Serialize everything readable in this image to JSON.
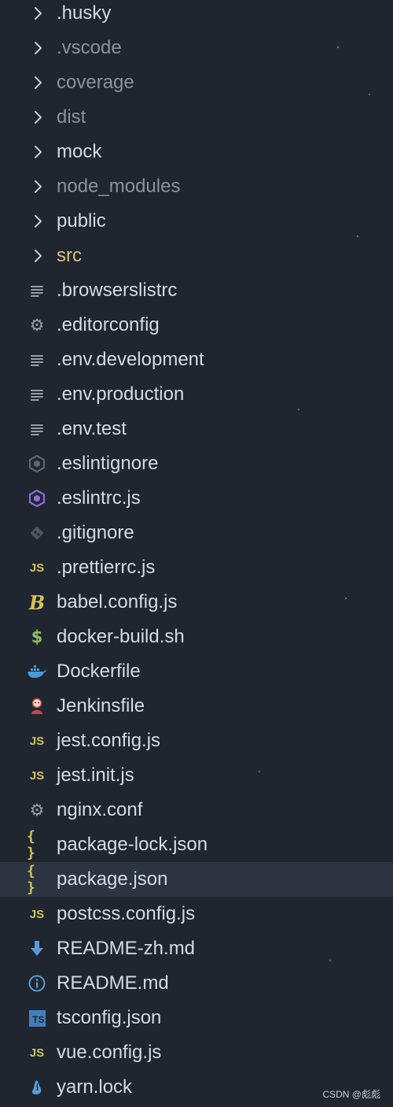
{
  "explorer": {
    "items": [
      {
        "label": ".husky",
        "kind": "folder",
        "icon": "chevron-right-icon"
      },
      {
        "label": ".vscode",
        "kind": "folder",
        "icon": "chevron-right-icon"
      },
      {
        "label": "coverage",
        "kind": "folder",
        "icon": "chevron-right-icon"
      },
      {
        "label": "dist",
        "kind": "folder",
        "icon": "chevron-right-icon"
      },
      {
        "label": "mock",
        "kind": "folder",
        "icon": "chevron-right-icon"
      },
      {
        "label": "node_modules",
        "kind": "folder",
        "icon": "chevron-right-icon"
      },
      {
        "label": "public",
        "kind": "folder",
        "icon": "chevron-right-icon"
      },
      {
        "label": "src",
        "kind": "folder",
        "icon": "chevron-right-icon"
      },
      {
        "label": ".browserslistrc",
        "kind": "file",
        "icon": "text-lines-icon"
      },
      {
        "label": ".editorconfig",
        "kind": "file",
        "icon": "gear-icon"
      },
      {
        "label": ".env.development",
        "kind": "file",
        "icon": "text-lines-icon"
      },
      {
        "label": ".env.production",
        "kind": "file",
        "icon": "text-lines-icon"
      },
      {
        "label": ".env.test",
        "kind": "file",
        "icon": "text-lines-icon"
      },
      {
        "label": ".eslintignore",
        "kind": "file",
        "icon": "eslint-gray-icon"
      },
      {
        "label": ".eslintrc.js",
        "kind": "file",
        "icon": "eslint-icon"
      },
      {
        "label": ".gitignore",
        "kind": "file",
        "icon": "git-icon"
      },
      {
        "label": ".prettierrc.js",
        "kind": "file",
        "icon": "javascript-icon"
      },
      {
        "label": "babel.config.js",
        "kind": "file",
        "icon": "babel-icon"
      },
      {
        "label": "docker-build.sh",
        "kind": "file",
        "icon": "shell-dollar-icon"
      },
      {
        "label": "Dockerfile",
        "kind": "file",
        "icon": "docker-whale-icon"
      },
      {
        "label": "Jenkinsfile",
        "kind": "file",
        "icon": "jenkins-icon"
      },
      {
        "label": "jest.config.js",
        "kind": "file",
        "icon": "javascript-icon"
      },
      {
        "label": "jest.init.js",
        "kind": "file",
        "icon": "javascript-icon"
      },
      {
        "label": "nginx.conf",
        "kind": "file",
        "icon": "gear-icon"
      },
      {
        "label": "package-lock.json",
        "kind": "file",
        "icon": "json-braces-icon"
      },
      {
        "label": "package.json",
        "kind": "file",
        "icon": "json-braces-icon",
        "selected": true
      },
      {
        "label": "postcss.config.js",
        "kind": "file",
        "icon": "javascript-icon"
      },
      {
        "label": "README-zh.md",
        "kind": "file",
        "icon": "download-arrow-icon"
      },
      {
        "label": "README.md",
        "kind": "file",
        "icon": "info-icon"
      },
      {
        "label": "tsconfig.json",
        "kind": "file",
        "icon": "typescript-icon"
      },
      {
        "label": "vue.config.js",
        "kind": "file",
        "icon": "javascript-icon"
      },
      {
        "label": "yarn.lock",
        "kind": "file",
        "icon": "yarn-icon"
      }
    ]
  },
  "icon_glyphs": {
    "javascript": "JS",
    "typescript": "TS",
    "shell": "$",
    "json": "{ }",
    "babel": "B"
  },
  "colors": {
    "background": "#1f2630",
    "selected_row": "#2b3440",
    "text": "#d6dae0",
    "dim_text": "#8a929c",
    "src_folder": "#d9c27a",
    "js_yellow": "#d6c25a",
    "eslint_purple": "#8e6bd8",
    "docker_blue": "#4a9bd6",
    "jenkins_red": "#c8464a"
  },
  "watermark": "CSDN @彪彪"
}
